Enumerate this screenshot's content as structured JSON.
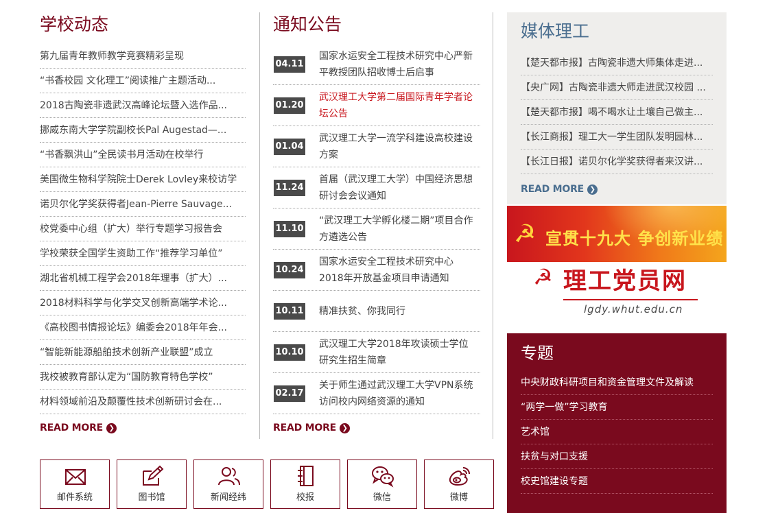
{
  "news": {
    "title": "学校动态",
    "items": [
      "第九届青年教师教学竞赛精彩呈现",
      "“书香校园 文化理工”阅读推广主题活动...",
      "2018古陶瓷非遗武汉高峰论坛暨入选作品...",
      "挪威东南大学学院副校长Pal Augestad—...",
      "“书香飘洪山”全民读书月活动在校举行",
      "美国微生物科学院院士Derek Lovley来校访学",
      "诺贝尔化学奖获得者Jean-Pierre Sauvage...",
      "校党委中心组（扩大）举行专题学习报告会",
      "学校荣获全国学生资助工作“推荐学习单位”",
      "湖北省机械工程学会2018年理事（扩大）...",
      "2018材料科学与化学交叉创新高端学术论...",
      "《高校图书情报论坛》编委会2018年年会...",
      "“智能新能源船舶技术创新产业联盟”成立",
      "我校被教育部认定为“国防教育特色学校”",
      "材料领域前沿及颠覆性技术创新研讨会在..."
    ],
    "read_more": "READ MORE"
  },
  "notices": {
    "title": "通知公告",
    "items": [
      {
        "date": "04.11",
        "text": "国家水运安全工程技术研究中心严新平教授团队招收博士后启事",
        "highlight": false
      },
      {
        "date": "01.20",
        "text": "武汉理工大学第二届国际青年学者论坛公告",
        "highlight": true
      },
      {
        "date": "01.04",
        "text": "武汉理工大学一流学科建设高校建设方案",
        "highlight": false
      },
      {
        "date": "11.24",
        "text": "首届（武汉理工大学）中国经济思想研讨会会议通知",
        "highlight": false
      },
      {
        "date": "11.10",
        "text": "“武汉理工大学孵化楼二期”项目合作方遴选公告",
        "highlight": false
      },
      {
        "date": "10.24",
        "text": "国家水运安全工程技术研究中心2018年开放基金项目申请通知",
        "highlight": false
      },
      {
        "date": "10.11",
        "text": "精准扶贫、你我同行",
        "highlight": false
      },
      {
        "date": "10.10",
        "text": "武汉理工大学2018年攻读硕士学位研究生招生简章",
        "highlight": false
      },
      {
        "date": "02.17",
        "text": "关于师生通过武汉理工大学VPN系统访问校内网络资源的通知",
        "highlight": false
      }
    ],
    "read_more": "READ MORE"
  },
  "media": {
    "title": "媒体理工",
    "items": [
      "【楚天都市报】古陶瓷非遗大师集体走进...",
      "【央广网】古陶瓷非遗大师走进武汉校园 ...",
      "【楚天都市报】喝不喝水让土壤自己做主...",
      "【长江商报】理工大一学生团队发明园林...",
      "【长江日报】诺贝尔化学奖获得者来汉讲..."
    ],
    "read_more": "READ MORE"
  },
  "banner": {
    "text": "宣贯十九大  争创新业绩",
    "emblem_icon": "hammer-sickle-icon"
  },
  "party_site": {
    "title": "理工党员网",
    "url": "lgdy.whut.edu.cn"
  },
  "topics": {
    "title": "专题",
    "items": [
      "中央财政科研项目和资金管理文件及解读",
      "“两学一做”学习教育",
      "艺术馆",
      "扶贫与对口支援",
      "校史馆建设专题"
    ]
  },
  "quick_links": [
    {
      "label": "邮件系统",
      "icon": "mail-icon"
    },
    {
      "label": "图书馆",
      "icon": "pen-icon"
    },
    {
      "label": "新闻经纬",
      "icon": "people-icon"
    },
    {
      "label": "校报",
      "icon": "newspaper-icon"
    },
    {
      "label": "微信",
      "icon": "wechat-icon"
    },
    {
      "label": "微博",
      "icon": "weibo-icon"
    }
  ],
  "colors": {
    "brand": "#7a0a1e",
    "media_accent": "#4a6e8f",
    "notice_highlight": "#c8161d",
    "date_badge": "#4a4a4a"
  }
}
